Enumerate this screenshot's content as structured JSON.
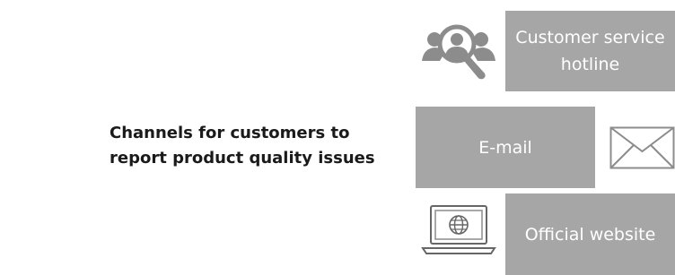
{
  "title": "Channels for customers to report product quality issues",
  "channels": [
    {
      "label": "Customer service hotline",
      "icon": "customer-service-search-icon"
    },
    {
      "label": "E-mail",
      "icon": "envelope-icon"
    },
    {
      "label": "Official website",
      "icon": "laptop-globe-icon"
    }
  ],
  "colors": {
    "box_fill": "#a6a6a6",
    "box_text": "#ffffff",
    "icon_gray": "#8c8c8c",
    "title_text": "#1a1a1a"
  }
}
